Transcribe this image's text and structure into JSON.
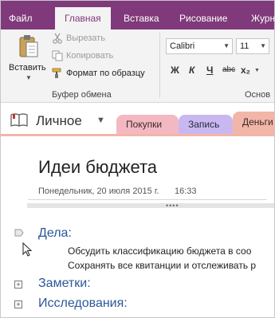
{
  "menu": {
    "tabs": [
      "Файл",
      "Главная",
      "Вставка",
      "Рисование",
      "Журн"
    ],
    "active": "Главная"
  },
  "ribbon": {
    "paste_label": "Вставить",
    "cut_label": "Вырезать",
    "copy_label": "Копировать",
    "format_painter_label": "Формат по образцу",
    "clipboard_group_label": "Буфер обмена",
    "font_name": "Calibri",
    "font_size": "11",
    "basic_text_group_label": "Основ",
    "format_buttons": [
      "Ж",
      "К",
      "Ч",
      "abc",
      "x₂"
    ]
  },
  "notebook": {
    "name": "Личное",
    "sections": [
      "Покупки",
      "Запись",
      "Деньги"
    ]
  },
  "page": {
    "title": "Идеи бюджета",
    "date": "Понедельник, 20 июля 2015 г.",
    "time": "16:33",
    "heading_tasks": "Дела:",
    "task_items": [
      "Обсудить классификацию бюджета в соо",
      "Сохранять все квитанции и отслеживать р"
    ],
    "heading_notes": "Заметки:",
    "heading_research": "Исследования:"
  },
  "colors": {
    "accent": "#80397b",
    "heading": "#2b579a",
    "section_pink": "#f4b8c3",
    "section_lavender": "#c9b8ef",
    "section_salmon": "#f2b6a8"
  }
}
